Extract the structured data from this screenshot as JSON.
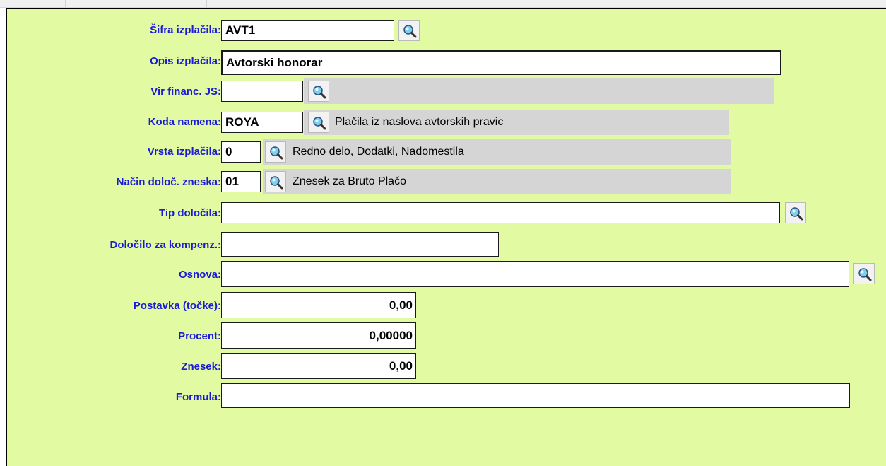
{
  "icons": {
    "lookup": "magnifier-icon"
  },
  "colors": {
    "panel_bg": "#e2fba2",
    "label": "#1a1ad8",
    "desc_bg": "#d5d5d5"
  },
  "form": {
    "sifra": {
      "label": "Šifra izplačila:",
      "value": "AVT1"
    },
    "opis": {
      "label": "Opis izplačila:",
      "value": "Avtorski honorar"
    },
    "vir": {
      "label": "Vir financ. JS:",
      "value": "",
      "desc": ""
    },
    "koda": {
      "label": "Koda namena:",
      "value": "ROYA",
      "desc": "Plačila iz naslova avtorskih pravic"
    },
    "vrsta": {
      "label": "Vrsta izplačila:",
      "value": "0",
      "desc": "Redno delo, Dodatki, Nadomestila"
    },
    "nacin": {
      "label": "Način določ. zneska:",
      "value": "01",
      "desc": "Znesek za Bruto Plačo"
    },
    "tip": {
      "label": "Tip določila:",
      "value": ""
    },
    "dolocilo": {
      "label": "Določilo za kompenz.:",
      "value": ""
    },
    "osnova": {
      "label": "Osnova:",
      "value": ""
    },
    "postavka": {
      "label": "Postavka (točke):",
      "value": "0,00"
    },
    "procent": {
      "label": "Procent:",
      "value": "0,00000"
    },
    "znesek": {
      "label": "Znesek:",
      "value": "0,00"
    },
    "formula": {
      "label": "Formula:",
      "value": ""
    }
  }
}
